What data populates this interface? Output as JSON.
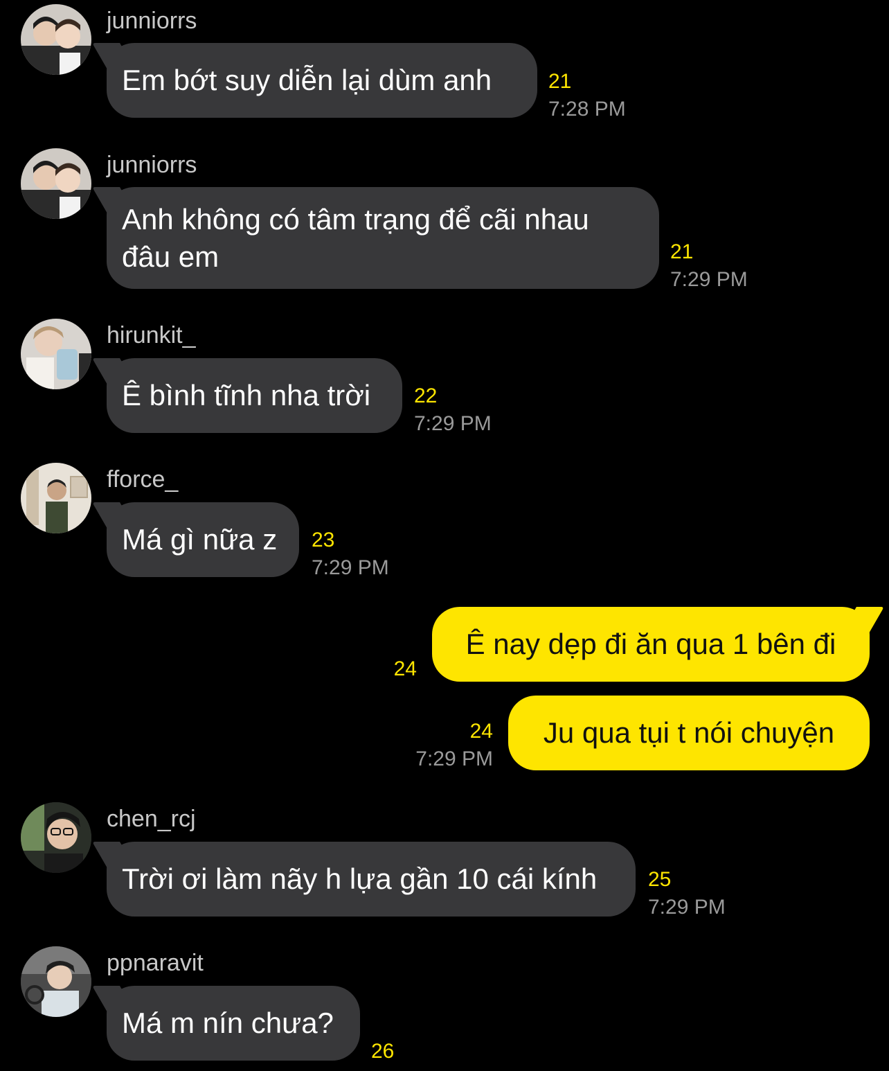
{
  "colors": {
    "background": "#000000",
    "incoming_bubble": "#38383a",
    "outgoing_bubble": "#fee500",
    "unread_count": "#fee500",
    "timestamp": "#9a9a9a",
    "sender_name": "#c8c8c8"
  },
  "messages": [
    {
      "sender": "junniorrs",
      "avatar": "avatar-junniorrs",
      "text": "Em bớt suy diễn lại dùm anh",
      "unread": "21",
      "time": "7:28 PM"
    },
    {
      "sender": "junniorrs",
      "avatar": "avatar-junniorrs",
      "text_line1": "Anh không có tâm trạng để cãi nhau",
      "text_line2": "đâu em",
      "unread": "21",
      "time": "7:29 PM"
    },
    {
      "sender": "hirunkit_",
      "avatar": "avatar-hirunkit",
      "text": "Ê bình tĩnh nha trời",
      "unread": "22",
      "time": "7:29 PM"
    },
    {
      "sender": "fforce_",
      "avatar": "avatar-fforce",
      "text": "Má gì nữa z",
      "unread": "23",
      "time": "7:29 PM"
    },
    {
      "sender": "me",
      "text": "Ê nay dẹp đi ăn qua 1 bên đi",
      "unread": "24"
    },
    {
      "sender": "me",
      "text": "Ju qua tụi t nói chuyện",
      "unread": "24",
      "time": "7:29 PM"
    },
    {
      "sender": "chen_rcj",
      "avatar": "avatar-chen",
      "text": "Trời ơi làm nãy h lựa gần 10 cái kính",
      "unread": "25",
      "time": "7:29 PM"
    },
    {
      "sender": "ppnaravit",
      "avatar": "avatar-ppnaravit",
      "text": "Má m nín chưa?",
      "unread": "26"
    }
  ]
}
